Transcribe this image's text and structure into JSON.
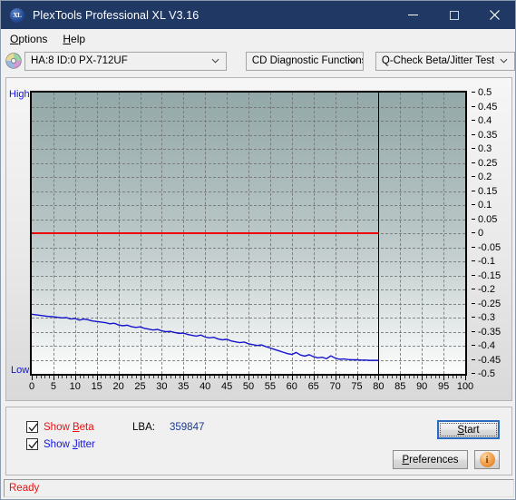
{
  "window": {
    "title": "PlexTools Professional XL V3.16",
    "app_icon": "xl-logo-icon",
    "minimize_label": "Minimize",
    "maximize_label": "Maximize",
    "close_label": "Close"
  },
  "menu": {
    "items": [
      {
        "label": "Options",
        "accel": "O"
      },
      {
        "label": "Help",
        "accel": "H"
      }
    ]
  },
  "selectors": {
    "drive_icon": "optical-disc-icon",
    "drive": {
      "value": "HA:8 ID:0  PX-712UF"
    },
    "function_group": {
      "value": "CD Diagnostic Functions"
    },
    "test": {
      "value": "Q-Check Beta/Jitter Test"
    }
  },
  "graph": {
    "axis_high_label": "High",
    "axis_low_label": "Low"
  },
  "controls": {
    "show_beta": {
      "label_prefix": "Show ",
      "accel": "B",
      "label_suffix": "eta",
      "checked": true
    },
    "show_jitter": {
      "label_prefix": "Show ",
      "accel": "J",
      "label_suffix": "itter",
      "checked": true
    },
    "lba_label": "LBA:",
    "lba_value": "359847",
    "start": {
      "prefix": "",
      "accel": "S",
      "suffix": "tart"
    },
    "preferences": {
      "prefix": "",
      "accel": "P",
      "suffix": "references"
    },
    "info": {
      "icon": "info-icon"
    }
  },
  "status": {
    "text": "Ready"
  },
  "chart_data": {
    "type": "line",
    "title": "Q-Check Beta/Jitter Test",
    "xlabel": "",
    "ylabel": "",
    "xlim": [
      0,
      100
    ],
    "ylim": [
      -0.5,
      0.5
    ],
    "grid": true,
    "legend_position": "below-left",
    "x_ticks": [
      0,
      5,
      10,
      15,
      20,
      25,
      30,
      35,
      40,
      45,
      50,
      55,
      60,
      65,
      70,
      75,
      80,
      85,
      90,
      95,
      100
    ],
    "y_ticks": [
      0.5,
      0.45,
      0.4,
      0.35,
      0.3,
      0.25,
      0.2,
      0.15,
      0.1,
      0.05,
      0,
      -0.05,
      -0.1,
      -0.15,
      -0.2,
      -0.25,
      -0.3,
      -0.35,
      -0.4,
      -0.45,
      -0.5
    ],
    "y_left_labels": [
      "High",
      "Low"
    ],
    "annotations": [
      {
        "type": "vline",
        "x": 80,
        "color": "#000000",
        "label": "end-of-data marker"
      }
    ],
    "series": [
      {
        "name": "Beta",
        "color": "#ee0000",
        "x": [
          0,
          2,
          4,
          6,
          8,
          10,
          12,
          14,
          16,
          18,
          20,
          22,
          24,
          26,
          28,
          30,
          32,
          34,
          36,
          38,
          40,
          42,
          44,
          46,
          48,
          50,
          52,
          54,
          56,
          58,
          60,
          62,
          64,
          66,
          68,
          70,
          72,
          74,
          76,
          78,
          80
        ],
        "values": [
          0,
          0,
          0,
          0,
          0,
          0,
          0,
          0,
          0,
          0,
          0,
          0,
          0,
          0,
          0,
          0,
          0,
          0,
          0,
          0,
          0,
          0,
          0,
          0,
          0,
          0,
          0,
          0,
          0,
          0,
          0,
          0,
          0,
          0,
          0,
          0,
          0,
          0,
          0,
          0,
          0
        ]
      },
      {
        "name": "Jitter",
        "color": "#1515cc",
        "x": [
          0,
          1,
          2,
          3,
          4,
          5,
          6,
          7,
          8,
          9,
          10,
          11,
          12,
          13,
          14,
          15,
          16,
          17,
          18,
          19,
          20,
          21,
          22,
          23,
          24,
          25,
          26,
          27,
          28,
          29,
          30,
          31,
          32,
          33,
          34,
          35,
          36,
          37,
          38,
          39,
          40,
          41,
          42,
          43,
          44,
          45,
          46,
          47,
          48,
          49,
          50,
          51,
          52,
          53,
          54,
          55,
          56,
          57,
          58,
          59,
          60,
          61,
          62,
          63,
          64,
          65,
          66,
          67,
          68,
          69,
          70,
          71,
          72,
          73,
          74,
          75,
          76,
          77,
          78,
          79,
          80
        ],
        "values": [
          -0.288,
          -0.29,
          -0.292,
          -0.294,
          -0.296,
          -0.297,
          -0.299,
          -0.301,
          -0.3,
          -0.305,
          -0.303,
          -0.309,
          -0.305,
          -0.308,
          -0.312,
          -0.314,
          -0.316,
          -0.318,
          -0.322,
          -0.32,
          -0.326,
          -0.329,
          -0.327,
          -0.332,
          -0.335,
          -0.333,
          -0.338,
          -0.341,
          -0.344,
          -0.342,
          -0.347,
          -0.35,
          -0.349,
          -0.353,
          -0.356,
          -0.355,
          -0.36,
          -0.363,
          -0.366,
          -0.362,
          -0.369,
          -0.372,
          -0.37,
          -0.376,
          -0.379,
          -0.377,
          -0.383,
          -0.386,
          -0.389,
          -0.387,
          -0.393,
          -0.396,
          -0.399,
          -0.397,
          -0.403,
          -0.408,
          -0.413,
          -0.418,
          -0.423,
          -0.428,
          -0.431,
          -0.424,
          -0.433,
          -0.437,
          -0.432,
          -0.439,
          -0.443,
          -0.441,
          -0.446,
          -0.436,
          -0.444,
          -0.448,
          -0.447,
          -0.449,
          -0.45,
          -0.45,
          -0.451,
          -0.451,
          -0.452,
          -0.452,
          -0.452
        ]
      }
    ]
  }
}
